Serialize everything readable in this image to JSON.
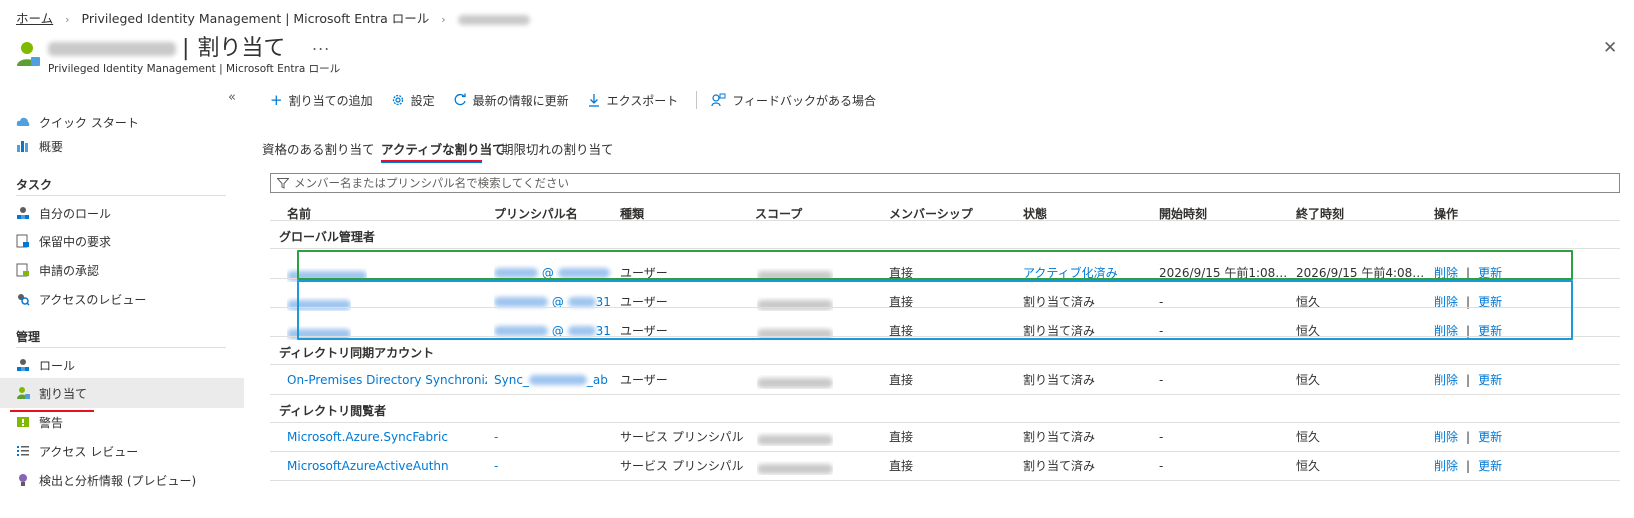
{
  "breadcrumb": {
    "home": "ホーム",
    "pim": "Privileged Identity Management | Microsoft Entra ロール"
  },
  "header": {
    "title_suffix": "割り当て",
    "subtitle": "Privileged Identity Management | Microsoft Entra ロール",
    "more": "...",
    "close": "✕"
  },
  "sidebar": {
    "collapse": "«",
    "top_items": [
      {
        "label": "クイック スタート",
        "icon": "cloud-icon"
      },
      {
        "label": "概要",
        "icon": "chart-icon"
      }
    ],
    "sections": [
      {
        "title": "タスク",
        "items": [
          {
            "label": "自分のロール",
            "icon": "user-roles-icon"
          },
          {
            "label": "保留中の要求",
            "icon": "pending-request-icon"
          },
          {
            "label": "申請の承認",
            "icon": "approve-request-icon"
          },
          {
            "label": "アクセスのレビュー",
            "icon": "access-review-icon"
          }
        ]
      },
      {
        "title": "管理",
        "items": [
          {
            "label": "ロール",
            "icon": "roles-icon"
          },
          {
            "label": "割り当て",
            "icon": "assignment-icon",
            "selected": true
          },
          {
            "label": "警告",
            "icon": "alert-icon"
          },
          {
            "label": "アクセス レビュー",
            "icon": "list-review-icon"
          },
          {
            "label": "検出と分析情報 (プレビュー)",
            "icon": "insights-icon"
          }
        ]
      }
    ]
  },
  "toolbar": {
    "add": "割り当ての追加",
    "settings": "設定",
    "refresh": "最新の情報に更新",
    "export": "エクスポート",
    "feedback": "フィードバックがある場合"
  },
  "tabs": {
    "eligible": "資格のある割り当て",
    "active": "アクティブな割り当て",
    "expired": "期限切れの割り当て"
  },
  "search": {
    "placeholder": "メンバー名またはプリンシパル名で検索してください"
  },
  "table": {
    "columns": [
      "名前",
      "プリンシパル名",
      "種類",
      "スコープ",
      "メンバーシップ",
      "状態",
      "開始時刻",
      "終了時刻",
      "操作"
    ],
    "op_delete": "削除",
    "op_separator": "|",
    "op_update": "更新",
    "groups": [
      {
        "title": "グローバル管理者",
        "rows": [
          {
            "principal_at": "@",
            "principal_suffix": "",
            "type": "ユーザー",
            "membership": "直接",
            "status": "アクティブ化済み",
            "status_link": true,
            "start": "2026/9/15 午前1:08…",
            "end": "2026/9/15 午前4:08…"
          },
          {
            "principal_at": "@",
            "principal_suffix": "31",
            "type": "ユーザー",
            "membership": "直接",
            "status": "割り当て済み",
            "status_link": false,
            "start": "-",
            "end": "恒久"
          },
          {
            "principal_at": "@",
            "principal_suffix": "31",
            "type": "ユーザー",
            "membership": "直接",
            "status": "割り当て済み",
            "status_link": false,
            "start": "-",
            "end": "恒久"
          }
        ]
      },
      {
        "title": "ディレクトリ同期アカウント",
        "rows": [
          {
            "name": "On-Premises Directory Synchroniza",
            "principal_prefix": "Sync_",
            "principal_suffix": "_ab",
            "type": "ユーザー",
            "membership": "直接",
            "status": "割り当て済み",
            "status_link": false,
            "start": "-",
            "end": "恒久"
          }
        ]
      },
      {
        "title": "ディレクトリ閲覧者",
        "rows": [
          {
            "name": "Microsoft.Azure.SyncFabric",
            "principal": "-",
            "type": "サービス プリンシパル",
            "membership": "直接",
            "status": "割り当て済み",
            "status_link": false,
            "start": "-",
            "end": "恒久"
          },
          {
            "name": "MicrosoftAzureActiveAuthn",
            "principal": "-",
            "type": "サービス プリンシパル",
            "membership": "直接",
            "status": "割り当て済み",
            "status_link": false,
            "start": "-",
            "end": "恒久"
          }
        ]
      }
    ]
  }
}
